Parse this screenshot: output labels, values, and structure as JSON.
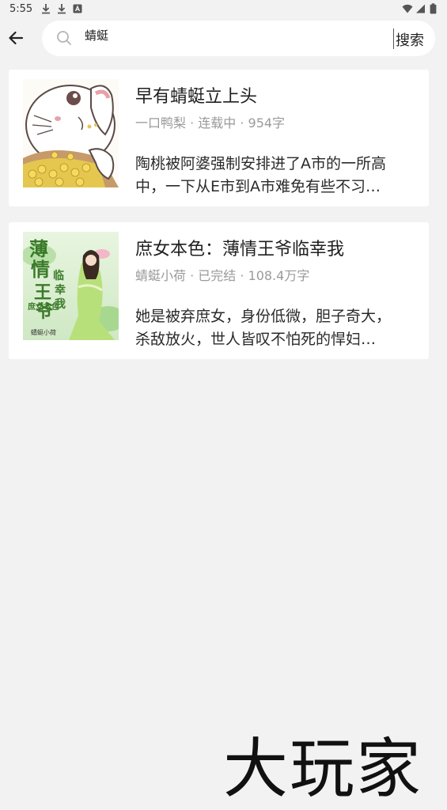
{
  "status_bar": {
    "time": "5:55"
  },
  "search": {
    "query": "蜻蜓",
    "submit_label": "搜索"
  },
  "results": [
    {
      "title": "早有蜻蜓立上头",
      "meta": "一口鸭梨 · 连载中 · 954字",
      "desc_line1": "陶桃被阿婆强制安排进了A市的一所高",
      "desc_line2": "中，一下从E市到A市难免有些不习"
    },
    {
      "title": "庶女本色：薄情王爷临幸我",
      "meta": "蜻蜓小荷 · 已完结 · 108.4万字",
      "desc_line1": "她是被弃庶女，身份低微，胆子奇大，",
      "desc_line2": "杀敌放火，世人皆叹不怕死的悍妇"
    }
  ],
  "watermark": "大玩家",
  "colors": {
    "background": "#f2f2f2",
    "card": "#ffffff",
    "meta": "#9a9a9a"
  }
}
